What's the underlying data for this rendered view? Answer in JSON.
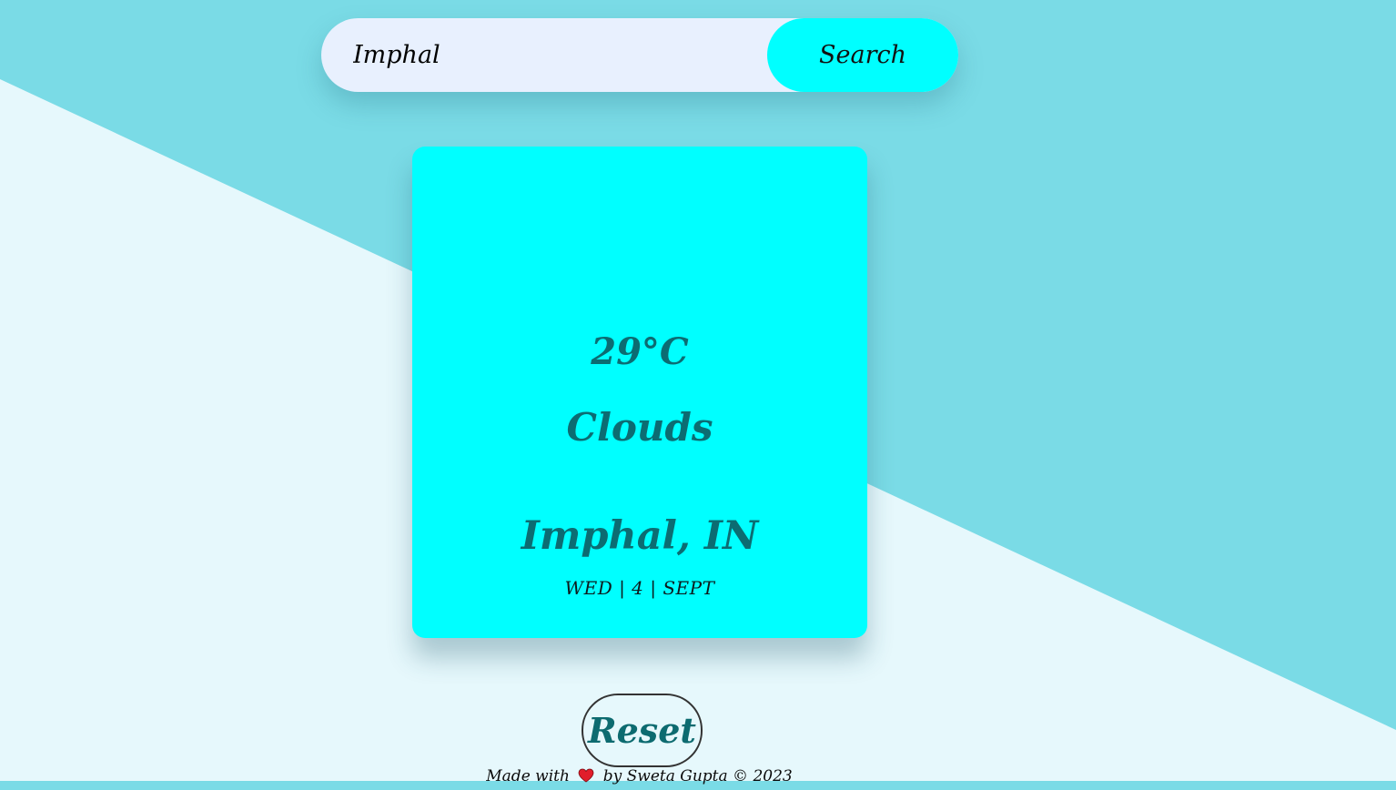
{
  "search": {
    "value": "Imphal",
    "button_label": "Search"
  },
  "weather": {
    "temperature": "29°C",
    "condition": "Clouds",
    "location": "Imphal, IN",
    "date": "WED | 4 | SEPT"
  },
  "reset_label": "Reset",
  "footer": {
    "prefix": "Made with",
    "heart_icon": "heart-icon",
    "suffix": "by Sweta Gupta © 2023"
  },
  "colors": {
    "background_dark": "#7adbe6",
    "background_light": "#e6f8fc",
    "accent": "#00ffff",
    "card_text": "#0c6c72"
  }
}
